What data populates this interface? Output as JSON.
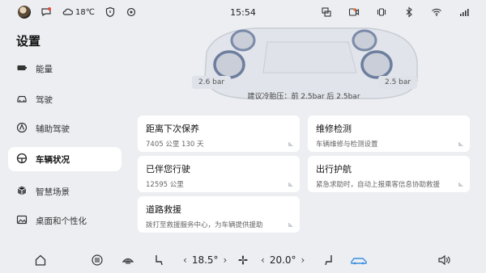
{
  "status": {
    "temperature": "18℃",
    "time": "15:54"
  },
  "sidebar": {
    "title": "设置",
    "items": [
      {
        "label": "能量",
        "icon": "battery-icon"
      },
      {
        "label": "驾驶",
        "icon": "car-icon"
      },
      {
        "label": "辅助驾驶",
        "icon": "assist-drive-icon"
      },
      {
        "label": "车辆状况",
        "icon": "vehicle-status-icon",
        "active": true
      },
      {
        "label": "智慧场景",
        "icon": "cube-icon"
      },
      {
        "label": "桌面和个性化",
        "icon": "image-icon"
      }
    ]
  },
  "tires": {
    "left_pressure": "2.6 bar",
    "right_pressure": "2.5 bar",
    "suggestion": "建议冷胎压：前 2.5bar 后 2.5bar"
  },
  "cards": [
    {
      "title": "距离下次保养",
      "sub": "7405 公里 130 天"
    },
    {
      "title": "维修检测",
      "sub": "车辆维修与检测设置"
    },
    {
      "title": "已伴您行驶",
      "sub": "12595 公里"
    },
    {
      "title": "出行护航",
      "sub": "紧急求助时，自动上报乘客信息协助救援"
    },
    {
      "title": "道路救援",
      "sub": "拨打至救援服务中心，为车辆提供援助"
    }
  ],
  "dock": {
    "left_temp": "18.5°",
    "right_temp": "20.0°",
    "arrow_left": "‹",
    "arrow_right": "›"
  },
  "colors": {
    "background": "#eceef2",
    "accent_blue": "#3a8fe0"
  }
}
